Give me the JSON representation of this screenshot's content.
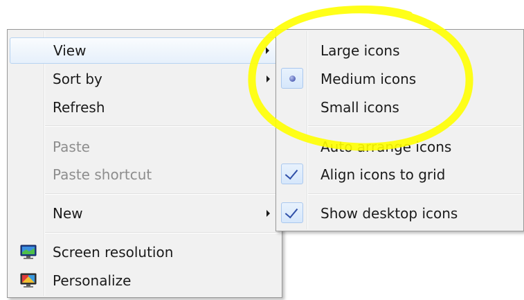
{
  "main_menu": {
    "items": [
      {
        "label": "View"
      },
      {
        "label": "Sort by"
      },
      {
        "label": "Refresh"
      },
      {
        "label": "Paste"
      },
      {
        "label": "Paste shortcut"
      },
      {
        "label": "New"
      },
      {
        "label": "Screen resolution",
        "icon": "screen-resolution-icon"
      },
      {
        "label": "Personalize",
        "icon": "personalize-icon"
      }
    ]
  },
  "view_submenu": {
    "items": [
      {
        "label": "Large icons"
      },
      {
        "label": "Medium icons",
        "selected": true
      },
      {
        "label": "Small icons"
      },
      {
        "label": "Auto arrange icons"
      },
      {
        "label": "Align icons to grid",
        "checked": true
      },
      {
        "label": "Show desktop icons",
        "checked": true
      }
    ]
  },
  "colors": {
    "menu_background": "#f1f1f1",
    "hover_border": "#b7d3f1",
    "annotation": "#ffff00"
  }
}
